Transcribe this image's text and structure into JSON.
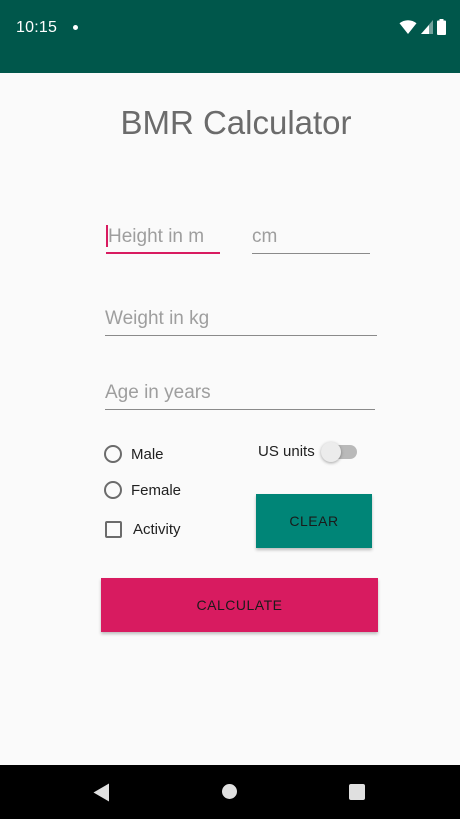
{
  "status_bar": {
    "time": "10:15",
    "icons": [
      "notification-dot-icon",
      "wifi-icon",
      "signal-icon",
      "battery-icon"
    ],
    "background_color": "#00574b"
  },
  "app": {
    "title": "BMR Calculator",
    "accent_color": "#d81b60",
    "primary_color": "#008577"
  },
  "form": {
    "height_m": {
      "value": "",
      "placeholder": "Height in m"
    },
    "height_cm": {
      "value": "",
      "placeholder": "cm"
    },
    "weight": {
      "value": "",
      "placeholder": "Weight in kg"
    },
    "age": {
      "value": "",
      "placeholder": "Age in years"
    },
    "gender_options": [
      {
        "label": "Male",
        "checked": false
      },
      {
        "label": "Female",
        "checked": false
      }
    ],
    "activity": {
      "label": "Activity",
      "checked": false
    },
    "us_units": {
      "label": "US units",
      "on": false
    }
  },
  "buttons": {
    "clear": "CLEAR",
    "calculate": "CALCULATE"
  },
  "nav_bar": {
    "icons": [
      "back-icon",
      "home-icon",
      "recents-icon"
    ]
  }
}
